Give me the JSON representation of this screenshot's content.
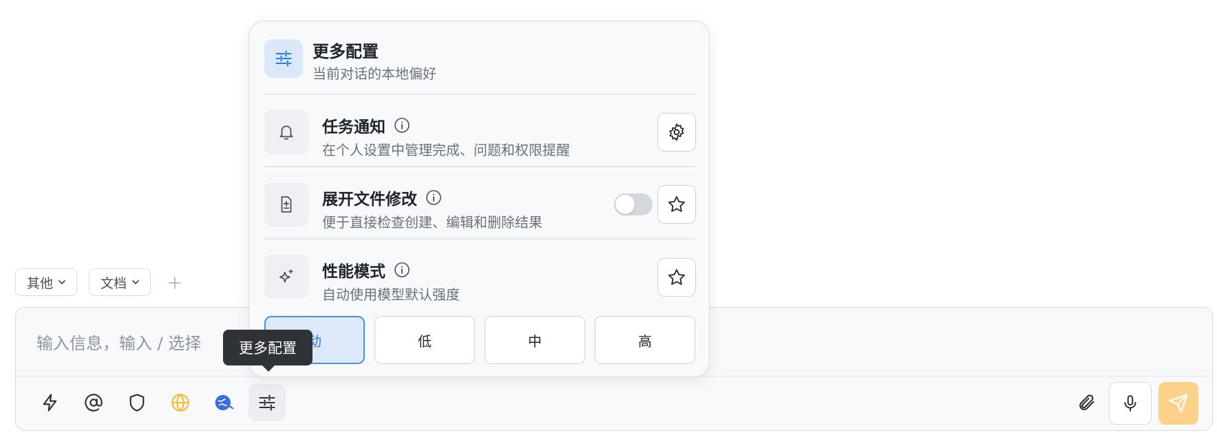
{
  "chips": [
    {
      "label": "其他"
    },
    {
      "label": "文档"
    }
  ],
  "composer": {
    "placeholder": "输入信息，输入 / 选择"
  },
  "tooltip": "更多配置",
  "panel": {
    "title": "更多配置",
    "subtitle": "当前对话的本地偏好",
    "rows": [
      {
        "title": "任务通知",
        "subtitle": "在个人设置中管理完成、问题和权限提醒",
        "icon": "bell-icon",
        "action": "gear-icon"
      },
      {
        "title": "展开文件修改",
        "subtitle": "便于直接检查创建、编辑和删除结果",
        "icon": "file-diff-icon",
        "action": "star-icon",
        "toggle_on": false
      },
      {
        "title": "性能模式",
        "subtitle": "自动使用模型默认强度",
        "icon": "sparkles-icon",
        "action": "star-icon"
      }
    ],
    "modes": [
      {
        "label": "动",
        "selected": true
      },
      {
        "label": "低",
        "selected": false
      },
      {
        "label": "中",
        "selected": false
      },
      {
        "label": "高",
        "selected": false
      }
    ]
  },
  "toolbar_icons": [
    "bolt-icon",
    "at-icon",
    "shield-icon",
    "globe-icon",
    "web-search-icon",
    "sliders-icon"
  ],
  "colors": {
    "accent": "#2a7ae2",
    "send": "#fcd28a",
    "globe": "#f5b82e"
  }
}
